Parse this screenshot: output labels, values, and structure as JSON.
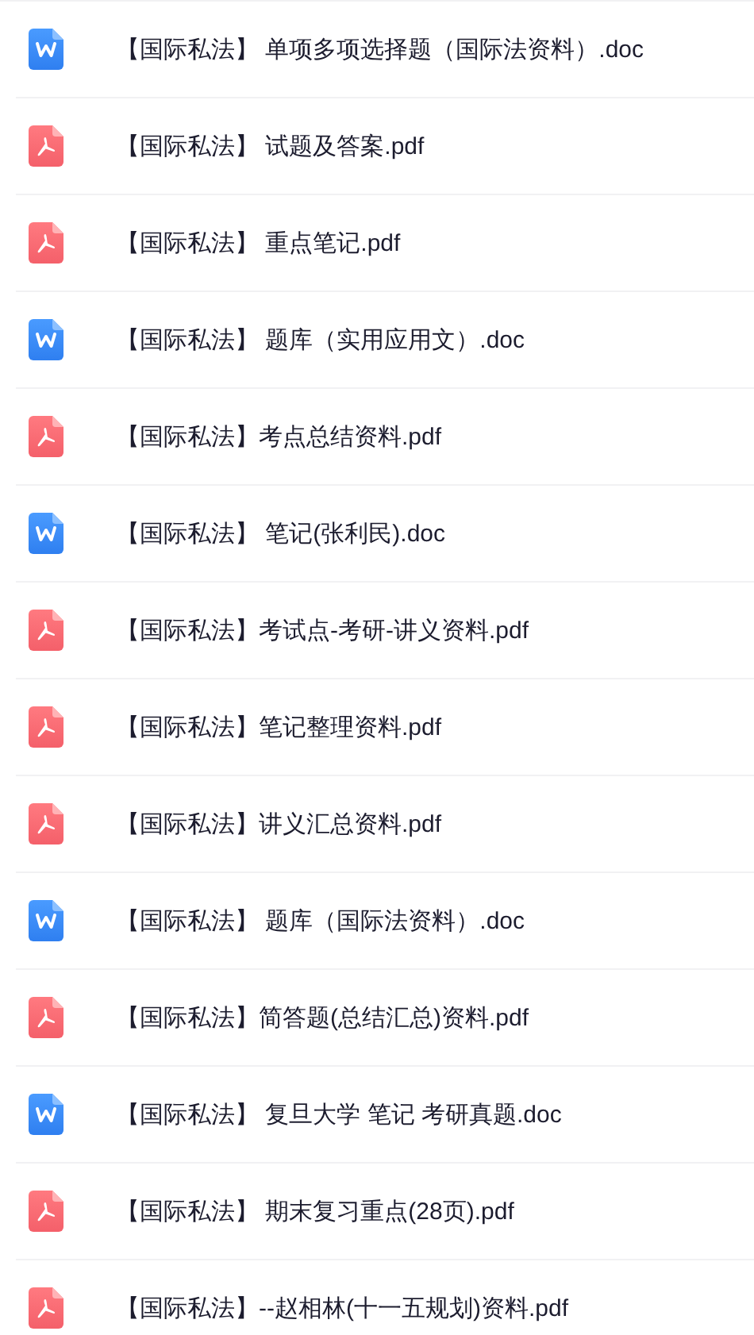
{
  "files": [
    {
      "kind": "doc",
      "name": "【国际私法】 单项多项选择题（国际法资料）.doc"
    },
    {
      "kind": "pdf",
      "name": "【国际私法】 试题及答案.pdf"
    },
    {
      "kind": "pdf",
      "name": "【国际私法】 重点笔记.pdf"
    },
    {
      "kind": "doc",
      "name": "【国际私法】 题库（实用应用文）.doc"
    },
    {
      "kind": "pdf",
      "name": "【国际私法】考点总结资料.pdf"
    },
    {
      "kind": "doc",
      "name": "【国际私法】 笔记(张利民).doc"
    },
    {
      "kind": "pdf",
      "name": "【国际私法】考试点-考研-讲义资料.pdf"
    },
    {
      "kind": "pdf",
      "name": "【国际私法】笔记整理资料.pdf"
    },
    {
      "kind": "pdf",
      "name": "【国际私法】讲义汇总资料.pdf"
    },
    {
      "kind": "doc",
      "name": "【国际私法】 题库（国际法资料）.doc"
    },
    {
      "kind": "pdf",
      "name": "【国际私法】简答题(总结汇总)资料.pdf"
    },
    {
      "kind": "doc",
      "name": "【国际私法】 复旦大学 笔记  考研真题.doc"
    },
    {
      "kind": "pdf",
      "name": "【国际私法】 期末复习重点(28页).pdf"
    },
    {
      "kind": "pdf",
      "name": "【国际私法】--赵相林(十一五规划)资料.pdf"
    }
  ]
}
